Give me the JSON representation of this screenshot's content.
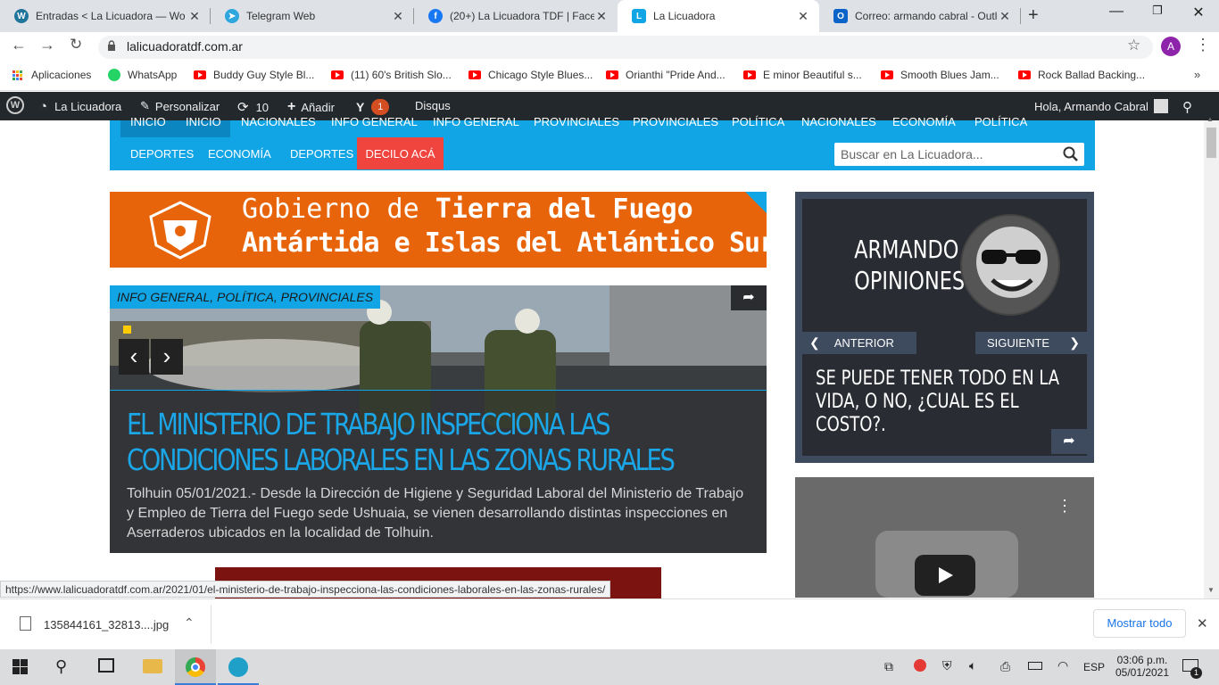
{
  "tabs": [
    {
      "title": "Entradas < La Licuadora — Wo",
      "icon": "wordpress-icon",
      "color": "#21759b"
    },
    {
      "title": "Telegram Web",
      "icon": "telegram-icon",
      "color": "#2ea6de"
    },
    {
      "title": "(20+) La Licuadora TDF | Faceb",
      "icon": "facebook-icon",
      "color": "#1877f2"
    },
    {
      "title": "La Licuadora",
      "icon": "licuadora-icon",
      "color": "#11a5e5"
    },
    {
      "title": "Correo: armando cabral - Outlo",
      "icon": "outlook-icon",
      "color": "#0a64c8"
    }
  ],
  "address": {
    "url": "lalicuadoratdf.com.ar",
    "profile_initial": "A"
  },
  "bookmarks": [
    {
      "label": "Aplicaciones",
      "icon": "apps-grid-icon"
    },
    {
      "label": "WhatsApp",
      "icon": "whatsapp-icon"
    },
    {
      "label": "Buddy Guy Style Bl...",
      "icon": "youtube-icon"
    },
    {
      "label": "(11) 60's British Slo...",
      "icon": "youtube-icon"
    },
    {
      "label": "Chicago Style Blues...",
      "icon": "youtube-icon"
    },
    {
      "label": "Orianthi \"Pride And...",
      "icon": "youtube-icon"
    },
    {
      "label": "E minor Beautiful s...",
      "icon": "youtube-icon"
    },
    {
      "label": "Smooth Blues Jam...",
      "icon": "youtube-icon"
    },
    {
      "label": "Rock Ballad Backing...",
      "icon": "youtube-icon"
    }
  ],
  "wpbar": {
    "site": "La Licuadora",
    "customize": "Personalizar",
    "updates": "10",
    "add": "Añadir",
    "yoast_count": "1",
    "disqus": "Disqus",
    "greeting": "Hola, Armando Cabral"
  },
  "nav": {
    "top_row": [
      "INICIO",
      "INICIO",
      "NACIONALES",
      "INFO GENERAL",
      "INFO GENERAL",
      "PROVINCIALES",
      "PROVINCIALES",
      "POLÍTICA",
      "NACIONALES",
      "ECONOMÍA",
      "POLÍTICA"
    ],
    "bottom_row": [
      "DEPORTES",
      "ECONOMÍA",
      "DEPORTES"
    ],
    "highlight": "DECILO ACÁ",
    "search_placeholder": "Buscar en La Licuadora..."
  },
  "banner": {
    "line1a": "Gobierno de ",
    "line1b": "Tierra del Fuego",
    "line2": "Antártida e Islas del Atlántico Sur"
  },
  "slider": {
    "categories": "INFO GENERAL, POLÍTICA, PROVINCIALES",
    "headline": "EL MINISTERIO DE TRABAJO INSPECCIONA LAS CONDICIONES LABORALES EN LAS ZONAS RURALES",
    "excerpt": "Tolhuin 05/01/2021.- Desde la Dirección de Higiene y Seguridad Laboral del Ministerio de Trabajo y Empleo de Tierra del Fuego sede Ushuaia, se vienen desarrollando distintas inspecciones en Aserraderos ubicados en la localidad de Tolhuin."
  },
  "opinion": {
    "title_line1": "ARMANDO",
    "title_line2": "OPINIONES",
    "prev": "ANTERIOR",
    "next": "SIGUIENTE",
    "headline": "SE PUEDE TENER TODO EN LA VIDA, O NO, ¿CUAL ES EL COSTO?."
  },
  "status_url": "https://www.lalicuadoratdf.com.ar/2021/01/el-ministerio-de-trabajo-inspecciona-las-condiciones-laborales-en-las-zonas-rurales/",
  "download": {
    "filename": "135844161_32813....jpg",
    "show_all": "Mostrar todo"
  },
  "taskbar": {
    "lang": "ESP",
    "time": "03:06 p.m.",
    "date": "05/01/2021",
    "notifications": "1"
  }
}
